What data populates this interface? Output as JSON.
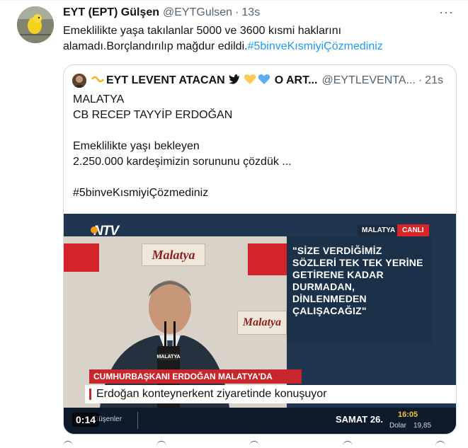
{
  "tweet": {
    "author_name": "EYT (EPT) Gülşen",
    "author_handle": "@EYTGulsen",
    "separator": "·",
    "time": "13s",
    "more_label": "···",
    "text": "Emeklilikte yaşa takılanlar 5000 ve 3600 kısmi haklarını alamadı.Borçlandırılıp mağdur edildi.",
    "hashtag": "#5binveKısmiyiÇözmediniz"
  },
  "quote": {
    "author_name_prefix_icon": "ribbon-icon",
    "author_name": "EYT LEVENT ATACAN",
    "name_emojis": [
      "bird-icon",
      "yellow-heart-icon",
      "blue-heart-icon"
    ],
    "author_name_suffix": "O ART...",
    "author_handle": "@EYTLEVENTA...",
    "separator": "·",
    "time": "21s",
    "lines": [
      "MALATYA",
      "CB RECEP TAYYİP ERDOĞAN",
      "",
      "Emeklilikte yaşı bekleyen",
      "2.250.000 kardeşimizin sorununu çözdük ...",
      "",
      "#5binveKısmiyiÇözmediniz"
    ]
  },
  "video": {
    "channel_logo": "NTV",
    "location_tag": "MALATYA",
    "live_tag": "CANLI",
    "quote_panel": "\"SİZE VERDİĞİMİZ SÖZLERİ TEK TEK YERİNE GETİRENE KADAR DURMADAN, DİNLENMEDEN ÇALIŞACAĞIZ\"",
    "banner_text": "Malatya",
    "podium_label": "MALATYA",
    "lower_third_title": "CUMHURBAŞKANI ERDOĞAN MALATYA'DA",
    "lower_third_subtitle": "Erdoğan konteynerkent ziyaretinde konuşuyor",
    "timestamp": "0:14",
    "ticker_label": "Düşenler",
    "ticker_news": "SAMAT  26.",
    "ticker_clock": "16:05",
    "ticker_fx_label": "Dolar",
    "ticker_fx_value": "19,85"
  }
}
